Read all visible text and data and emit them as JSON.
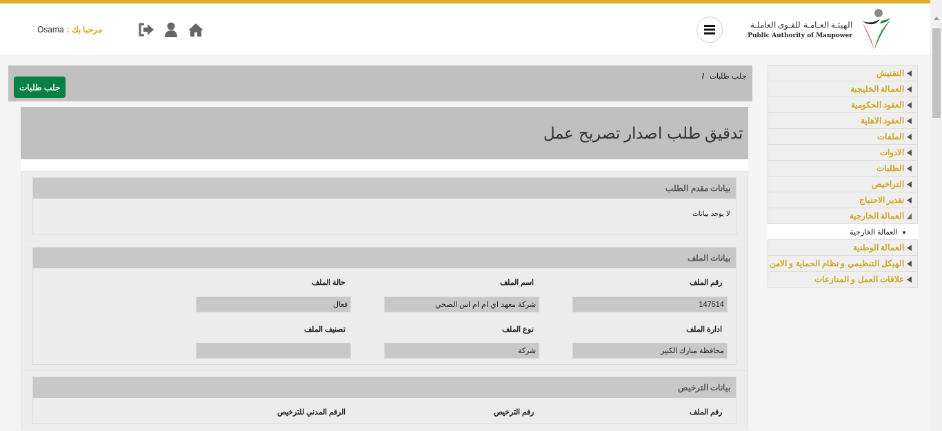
{
  "header": {
    "logo_arabic": "الهيئـة العـامـة للقـوى العاملـة",
    "logo_english": "Public Authority of Manpower",
    "welcome_label": "مرحبا بك :",
    "user_name": "Osama"
  },
  "breadcrumb": {
    "items": [
      "جلب طلبات"
    ],
    "separator": "/"
  },
  "action_button": "جلب طلبات",
  "page_title": "تدقيق طلب اصدار تصريح عمل",
  "sections": [
    {
      "title": "بيانات مقدم الطلب",
      "empty_text": "لا يوجد بيانات"
    },
    {
      "title": "بيانات الملف",
      "kind": "form",
      "fields": [
        {
          "label": "رقم الملف",
          "value": "147514"
        },
        {
          "label": "اسم الملف",
          "value": "شركة معهد اي ام ام اس الصحي"
        },
        {
          "label": "حالة الملف",
          "value": "فعال"
        },
        {
          "label": "ادارة الملف",
          "value": "محافظة مبارك الكبير"
        },
        {
          "label": "نوع الملف",
          "value": "شركة"
        },
        {
          "label": "تصنيف الملف"
        }
      ]
    },
    {
      "title": "بيانات الترخيص",
      "kind": "labels",
      "fields": [
        {
          "label": "رقم الملف"
        },
        {
          "label": "رقم الترخيص"
        },
        {
          "label": "الرقم المدني للترخيص"
        }
      ]
    }
  ],
  "sidebar": {
    "items": [
      {
        "label": "التفتيش",
        "expanded": false
      },
      {
        "label": "العمالة الخليجية",
        "expanded": false
      },
      {
        "label": "العقود الحكومية",
        "expanded": false
      },
      {
        "label": "العقود الاهلية",
        "expanded": false
      },
      {
        "label": "الملفات",
        "expanded": false
      },
      {
        "label": "الادوات",
        "expanded": false
      },
      {
        "label": "الطلبات",
        "expanded": false
      },
      {
        "label": "التراخيص",
        "expanded": false
      },
      {
        "label": "تقدير الاحتياج",
        "expanded": false
      },
      {
        "label": "العمالة الخارجية",
        "expanded": true,
        "children": [
          {
            "label": "العمالة الخارجية"
          }
        ]
      },
      {
        "label": "العمالة الوطنية",
        "expanded": false
      },
      {
        "label": "الهيكل التنظيمي و نظام الحماية و الامن",
        "expanded": false
      },
      {
        "label": "علاقات العمل و المنازعات",
        "expanded": false
      }
    ]
  }
}
